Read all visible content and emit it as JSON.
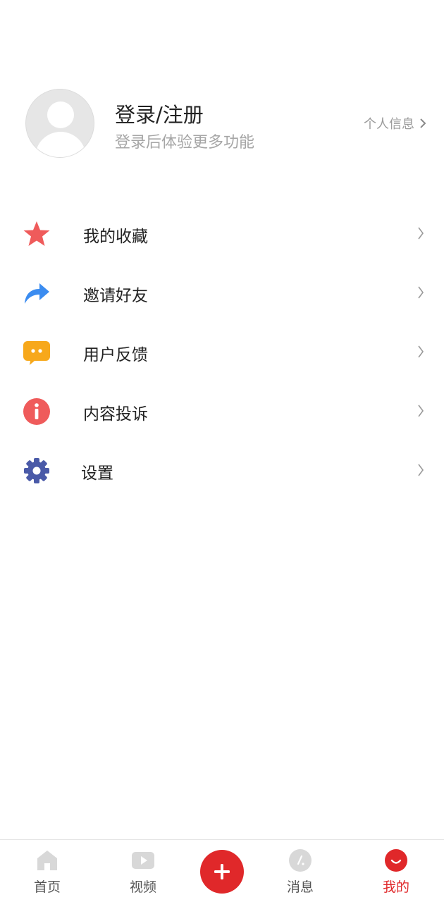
{
  "profile": {
    "title": "登录/注册",
    "subtitle": "登录后体验更多功能",
    "info_link": "个人信息"
  },
  "menu": {
    "items": [
      {
        "label": "我的收藏",
        "icon": "star-icon",
        "color": "#ef5b5b"
      },
      {
        "label": "邀请好友",
        "icon": "share-arrow-icon",
        "color": "#3b8cf0"
      },
      {
        "label": "用户反馈",
        "icon": "chat-bubble-icon",
        "color": "#f7a81b"
      },
      {
        "label": "内容投诉",
        "icon": "info-icon",
        "color": "#ef5b5b"
      },
      {
        "label": "设置",
        "icon": "gear-icon",
        "color": "#4a5aa8"
      }
    ]
  },
  "tabbar": {
    "tabs": [
      {
        "label": "首页",
        "icon": "home-icon"
      },
      {
        "label": "视频",
        "icon": "video-icon"
      },
      {
        "label": "",
        "icon": "plus-icon"
      },
      {
        "label": "消息",
        "icon": "message-icon"
      },
      {
        "label": "我的",
        "icon": "profile-smile-icon",
        "active": true
      }
    ],
    "accent_color": "#e0282a"
  }
}
